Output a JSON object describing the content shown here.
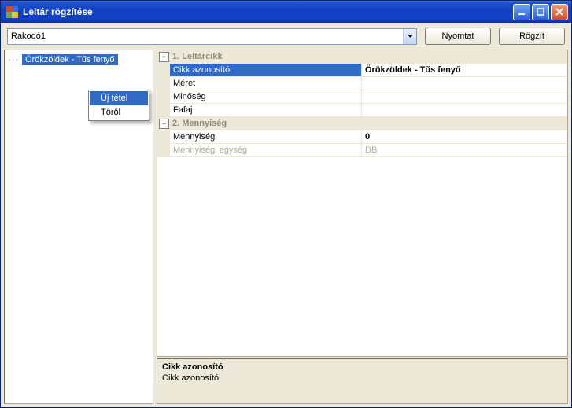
{
  "window": {
    "title": "Leltár rögzítése"
  },
  "toolbar": {
    "combo_value": "Rakodó1",
    "print_label": "Nyomtat",
    "save_label": "Rögzít"
  },
  "tree": {
    "items": [
      {
        "label": "Örökzöldek - Tűs fenyő",
        "selected": true
      }
    ]
  },
  "contextmenu": {
    "items": [
      {
        "label": "Új tétel",
        "highlight": true
      },
      {
        "label": "Töröl",
        "highlight": false
      }
    ]
  },
  "propgrid": {
    "categories": [
      {
        "label": "1. Leltárcikk",
        "rows": [
          {
            "name": "Cikk azonosító",
            "value": "Örökzöldek - Tűs fenyő",
            "selected": true
          },
          {
            "name": "Méret",
            "value": ""
          },
          {
            "name": "Minőség",
            "value": ""
          },
          {
            "name": "Fafaj",
            "value": ""
          }
        ]
      },
      {
        "label": "2. Mennyiség",
        "rows": [
          {
            "name": "Mennyiség",
            "value": "0",
            "bold": true
          },
          {
            "name": "Mennyiségi egység",
            "value": "DB",
            "disabled": true
          }
        ]
      }
    ]
  },
  "description": {
    "title": "Cikk azonosító",
    "text": "Cikk azonosító"
  }
}
